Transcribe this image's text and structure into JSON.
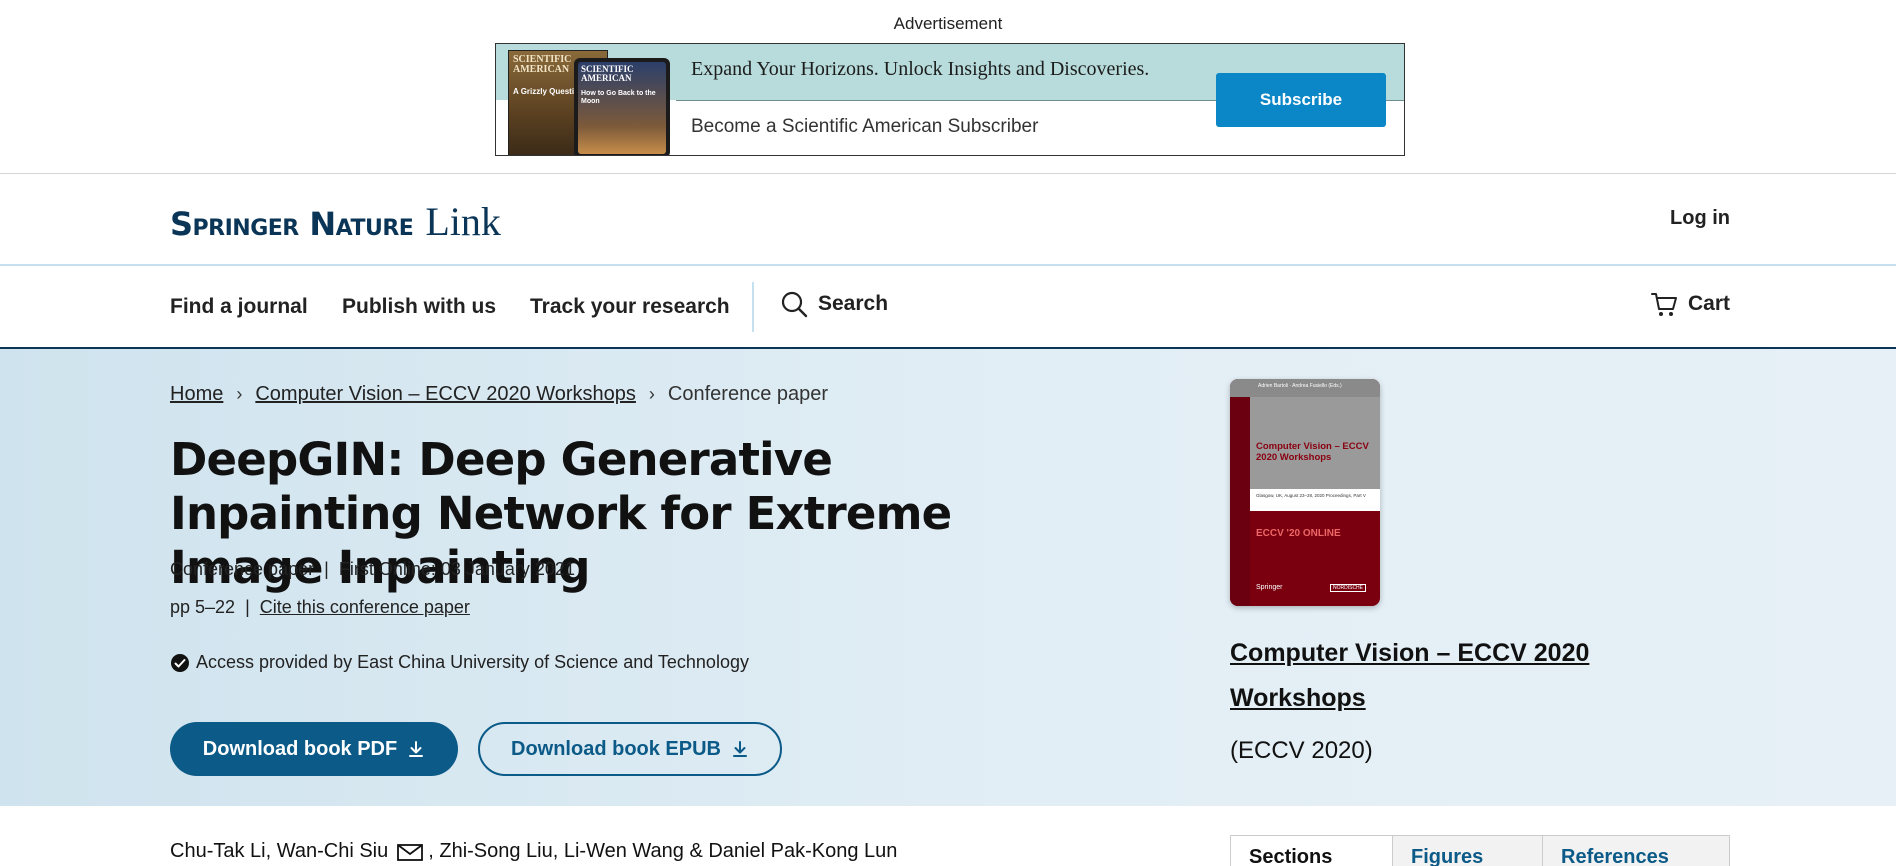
{
  "ad": {
    "label": "Advertisement",
    "mag1_title": "SCIENTIFIC AMERICAN",
    "mag1_subtitle": "A Grizzly Question",
    "mag2_title": "SCIENTIFIC AMERICAN",
    "mag2_subtitle": "How to Go Back to the Moon",
    "headline": "Expand Your Horizons. Unlock Insights and Discoveries.",
    "subline": "Become a Scientific American Subscriber",
    "button_label": "Subscribe"
  },
  "header": {
    "brand_primary": "Springer Nature",
    "brand_secondary": "Link",
    "login_label": "Log in"
  },
  "nav": {
    "items": [
      "Find a journal",
      "Publish with us",
      "Track your research"
    ],
    "search_label": "Search",
    "cart_label": "Cart"
  },
  "breadcrumb": {
    "home": "Home",
    "book": "Computer Vision – ECCV 2020 Workshops",
    "current": "Conference paper"
  },
  "paper": {
    "title": "DeepGIN: Deep Generative Inpainting Network for Extreme Image Inpainting",
    "type": "Conference paper",
    "first_online": "First Online: 03 January 2021",
    "pages": "pp 5–22",
    "cite_label": "Cite this conference paper",
    "access_text": "Access provided by East China University of Science and Technology",
    "download_pdf": "Download book PDF",
    "download_epub": "Download book EPUB",
    "authors_part1": "Chu-Tak Li, Wan-Chi Siu",
    "authors_part2": ", Zhi-Song Liu, Li-Wen Wang & Daniel Pak-Kong Lun"
  },
  "book": {
    "cover_editors": "Adrien Bartoli · Andrea Fusiello (Eds.)",
    "cover_title": "Computer Vision – ECCV 2020 Workshops",
    "cover_details": "Glasgow, UK, August 23–28, 2020 Proceedings, Part V",
    "cover_event": "ECCV '20 ONLINE",
    "cover_publisher": "Springer",
    "cover_badge": "NORDISCHE",
    "title": "Computer Vision – ECCV 2020 Workshops",
    "abbr": "(ECCV 2020)"
  },
  "tabs": {
    "items": [
      "Sections",
      "Figures",
      "References"
    ],
    "active": "Sections"
  },
  "colors": {
    "brand": "#0a3557",
    "primary_button": "#0b5a87",
    "subscribe_button": "#0b86c6",
    "hero_background": "#dbeaf3"
  }
}
